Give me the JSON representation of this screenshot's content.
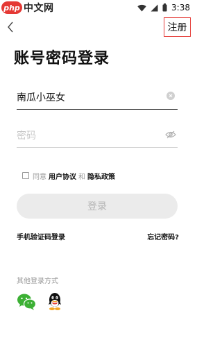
{
  "status_bar": {
    "app_badge": "php",
    "app_label": "中文网",
    "time": "3:38"
  },
  "header": {
    "register_label": "注册"
  },
  "page_title": "账号密码登录",
  "username": {
    "value": "南瓜小巫女"
  },
  "password": {
    "placeholder": "密码"
  },
  "agreement": {
    "prefix": "同意",
    "user_agreement": "用户协议",
    "and": "和",
    "privacy_policy": "隐私政策"
  },
  "login_button": "登录",
  "sms_login": "手机验证码登录",
  "forgot_password": "忘记密码?",
  "other_login": {
    "label": "其他登录方式",
    "methods": [
      "wechat-icon",
      "qq-icon"
    ]
  },
  "colors": {
    "highlight_border": "#e53935",
    "wechat": "#3cb034",
    "button_bg": "#ebebeb"
  }
}
